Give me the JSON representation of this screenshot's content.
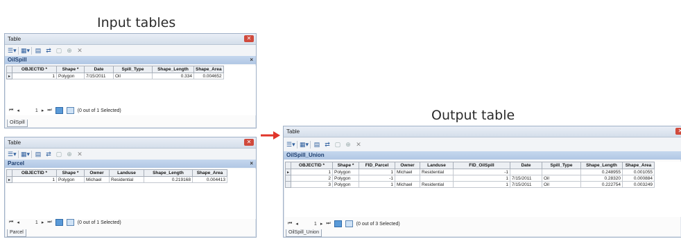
{
  "headings": {
    "input": "Input tables",
    "output": "Output table"
  },
  "icons": {
    "table_options": "table-options-icon",
    "related": "related-tables-icon",
    "select_by_attr": "select-by-attributes-icon",
    "switch_sel": "switch-selection-icon",
    "clear_sel": "clear-selection-icon",
    "zoom_sel": "zoom-to-selected-icon",
    "delete": "delete-selected-icon"
  },
  "colors": {
    "arrow": "#e0352a",
    "close": "#d04a3c",
    "layer_bar": "#b9cde7"
  },
  "windows": [
    {
      "title": "Table",
      "layer": "OilSpill",
      "columns": [
        "OBJECTID *",
        "Shape *",
        "Date",
        "Spill_Type",
        "Shape_Length",
        "Shape_Area"
      ],
      "rows": [
        [
          "1",
          "Polygon",
          "7/15/2011",
          "Oil",
          "0.334",
          "0.004652"
        ]
      ],
      "nav_record": "1",
      "status": "(0 out of 1 Selected)",
      "tab": "OilSpill"
    },
    {
      "title": "Table",
      "layer": "Parcel",
      "columns": [
        "OBJECTID *",
        "Shape *",
        "Owner",
        "Landuse",
        "Shape_Length",
        "Shape_Area"
      ],
      "rows": [
        [
          "1",
          "Polygon",
          "Michael",
          "Residential",
          "0.219168",
          "0.004413"
        ]
      ],
      "nav_record": "1",
      "status": "(0 out of 1 Selected)",
      "tab": "Parcel"
    },
    {
      "title": "Table",
      "layer": "OilSpill_Union",
      "columns": [
        "OBJECTID *",
        "Shape *",
        "FID_Parcel",
        "Owner",
        "Landuse",
        "FID_OilSpill",
        "Date",
        "Spill_Type",
        "Shape_Length",
        "Shape_Area"
      ],
      "rows": [
        [
          "1",
          "Polygon",
          "1",
          "Michael",
          "Residential",
          "-1",
          "",
          "",
          "0.248955",
          "0.001055"
        ],
        [
          "2",
          "Polygon",
          "-1",
          "",
          "",
          "1",
          "7/15/2011",
          "Oil",
          "0.28320",
          "0.000884"
        ],
        [
          "3",
          "Polygon",
          "1",
          "Michael",
          "Residential",
          "1",
          "7/15/2011",
          "Oil",
          "0.222754",
          "0.003249"
        ]
      ],
      "nav_record": "1",
      "status": "(0 out of 3 Selected)",
      "tab": "OilSpill_Union"
    }
  ]
}
